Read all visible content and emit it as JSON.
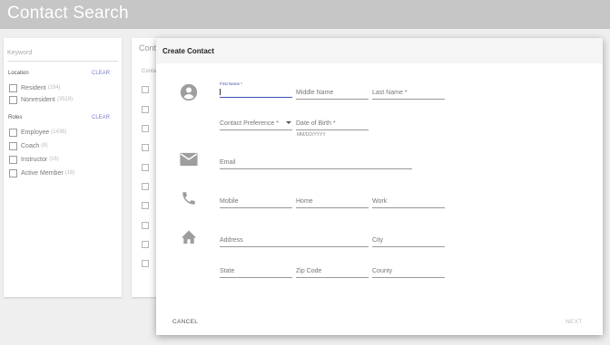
{
  "app": {
    "title": "Contact Search"
  },
  "filters": {
    "keyword_placeholder": "Keyword",
    "location": {
      "title": "Location",
      "clear": "CLEAR",
      "options": [
        {
          "label": "Resident",
          "count": "(194)"
        },
        {
          "label": "Nonresident",
          "count": "(3529)"
        }
      ]
    },
    "roles": {
      "title": "Roles",
      "clear": "CLEAR",
      "options": [
        {
          "label": "Employee",
          "count": "(1436)"
        },
        {
          "label": "Coach",
          "count": "(8)"
        },
        {
          "label": "Instructor",
          "count": "(16)"
        },
        {
          "label": "Active Member",
          "count": "(18)"
        }
      ]
    }
  },
  "list": {
    "title": "Cont",
    "header": "Conta"
  },
  "modal": {
    "title": "Create Contact",
    "fields": {
      "first_name_label": "First Name *",
      "middle_name": "Middle Name",
      "last_name": "Last Name *",
      "contact_preference": "Contact Preference *",
      "dob": "Date of Birth *",
      "dob_hint": "MM/DD/YYYY",
      "email": "Email",
      "mobile": "Mobile",
      "home": "Home",
      "work": "Work",
      "address": "Address",
      "city": "City",
      "state": "State",
      "zip": "Zip Code",
      "county": "County"
    },
    "cancel": "CANCEL",
    "next": "NEXT"
  },
  "colors": {
    "accent": "#3f51b5",
    "icon": "#9e9e9e",
    "topbar": "#c6c6c6",
    "link": "#7b7fc9"
  }
}
